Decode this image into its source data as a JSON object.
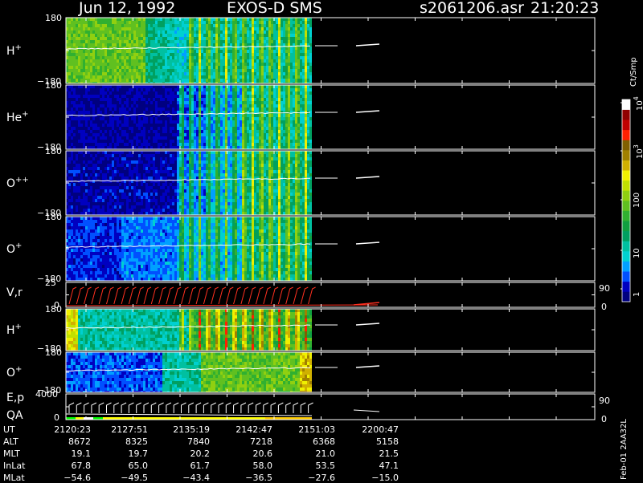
{
  "header": {
    "date": "Jun 12, 1992",
    "instrument": "EXOS-D SMS",
    "file": "s2061206.asr",
    "time": "21:20:23"
  },
  "colorbar": {
    "unit": "Ct/Smp",
    "ticks": [
      "1",
      "10",
      "100",
      "10",
      "10"
    ],
    "exponents": [
      "",
      "",
      "",
      "3",
      "4"
    ],
    "colors": [
      "#000080",
      "#0000c0",
      "#0050ff",
      "#00a0ff",
      "#00d0d0",
      "#00c0a0",
      "#00a060",
      "#10a040",
      "#30b030",
      "#60c020",
      "#90d010",
      "#c0e000",
      "#f0f000",
      "#d0b000",
      "#a08000",
      "#806000",
      "#ff2000",
      "#c00000",
      "#900000",
      "#ffffff"
    ]
  },
  "footer_id": "Feb-01 2AA32L",
  "chart_data": [
    {
      "type": "heatmap",
      "id": "h-plus-1",
      "label": "H",
      "sup": "+",
      "y_top": "180",
      "y_bottom": "−180",
      "ylim": [
        -180,
        180
      ]
    },
    {
      "type": "heatmap",
      "id": "he-plus",
      "label": "He",
      "sup": "+",
      "y_top": "180",
      "y_bottom": "−180",
      "ylim": [
        -180,
        180
      ]
    },
    {
      "type": "heatmap",
      "id": "o-plus-plus",
      "label": "O",
      "sup": "++",
      "y_top": "180",
      "y_bottom": "−180",
      "ylim": [
        -180,
        180
      ]
    },
    {
      "type": "heatmap",
      "id": "o-plus-1",
      "label": "O",
      "sup": "+",
      "y_top": "180",
      "y_bottom": "−180",
      "ylim": [
        -180,
        180
      ]
    },
    {
      "type": "line",
      "id": "v-r",
      "label": "V,r",
      "sup": "",
      "y_top": "25",
      "y_bottom": "0",
      "right_top": "90",
      "right_bottom": "0",
      "ylim": [
        0,
        25
      ]
    },
    {
      "type": "heatmap",
      "id": "h-plus-2",
      "label": "H",
      "sup": "+",
      "y_top": "180",
      "y_bottom": "−180",
      "ylim": [
        -180,
        180
      ]
    },
    {
      "type": "heatmap",
      "id": "o-plus-2",
      "label": "O",
      "sup": "+",
      "y_top": "180",
      "y_bottom": "−180",
      "ylim": [
        -180,
        180
      ]
    },
    {
      "type": "line",
      "id": "e-p-qa",
      "label": "E,p",
      "label2": "QA",
      "sup": "",
      "y_top": "4000",
      "y_bottom": "0",
      "right_top": "90",
      "right_bottom": "0",
      "ylim": [
        0,
        4000
      ]
    }
  ],
  "ephemeris": {
    "row_labels": [
      "UT",
      "ALT",
      "MLT",
      "InLat",
      "MLat"
    ],
    "columns": [
      {
        "UT": "2120:23",
        "ALT": "8672",
        "MLT": "19.1",
        "InLat": "67.8",
        "MLat": "−54.6"
      },
      {
        "UT": "2127:51",
        "ALT": "8325",
        "MLT": "19.7",
        "InLat": "65.0",
        "MLat": "−49.5"
      },
      {
        "UT": "2135:19",
        "ALT": "7840",
        "MLT": "20.2",
        "InLat": "61.7",
        "MLat": "−43.4"
      },
      {
        "UT": "2142:47",
        "ALT": "7218",
        "MLT": "20.6",
        "InLat": "58.0",
        "MLat": "−36.5"
      },
      {
        "UT": "2151:03",
        "ALT": "6368",
        "MLT": "21.0",
        "InLat": "53.5",
        "MLat": "−27.6"
      },
      {
        "UT": "2200:47",
        "ALT": "5158",
        "MLT": "21.5",
        "InLat": "47.1",
        "MLat": "−15.0"
      }
    ]
  }
}
